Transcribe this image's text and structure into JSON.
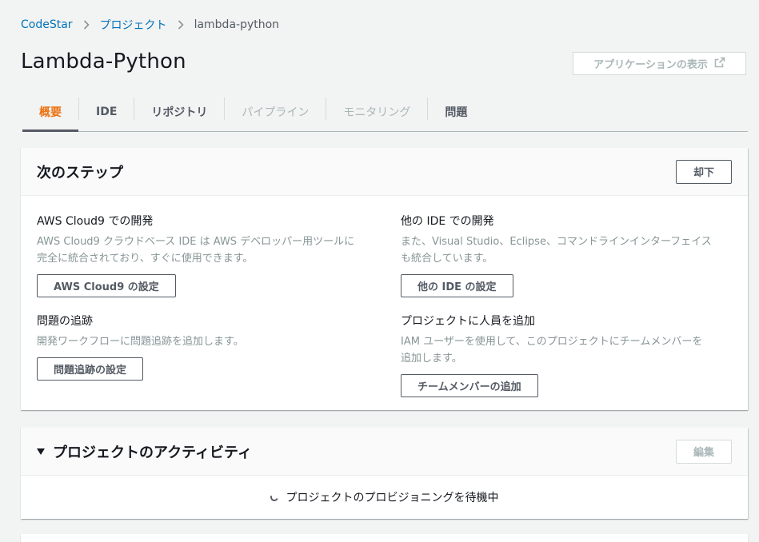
{
  "breadcrumb": {
    "items": [
      {
        "label": "CodeStar"
      },
      {
        "label": "プロジェクト"
      }
    ],
    "current": "lambda-python"
  },
  "page": {
    "title": "Lambda-Python",
    "view_app_label": "アプリケーションの表示",
    "view_app_icon": "external-link-icon"
  },
  "tabs": [
    {
      "label": "概要",
      "state": "active"
    },
    {
      "label": "IDE",
      "state": "enabled"
    },
    {
      "label": "リポジトリ",
      "state": "enabled"
    },
    {
      "label": "パイプライン",
      "state": "disabled"
    },
    {
      "label": "モニタリング",
      "state": "disabled"
    },
    {
      "label": "問題",
      "state": "enabled"
    }
  ],
  "next_steps": {
    "title": "次のステップ",
    "dismiss_label": "却下",
    "cards": [
      {
        "title": "AWS Cloud9 での開発",
        "desc_line1": "AWS Cloud9 クラウドベース IDE は AWS デベロッパー用ツールに",
        "desc_line2": "完全に統合されており、すぐに使用できます。",
        "button": "AWS Cloud9 の設定"
      },
      {
        "title": "他の IDE での開発",
        "desc_line1": "また、Visual Studio、Eclipse、コマンドラインインターフェイス",
        "desc_line2": "も統合しています。",
        "button": "他の IDE の設定"
      },
      {
        "title": "問題の追跡",
        "desc_line1": "開発ワークフローに問題追跡を追加します。",
        "desc_line2": "",
        "button": "問題追跡の設定"
      },
      {
        "title": "プロジェクトに人員を追加",
        "desc_line1": "IAM ユーザーを使用して、このプロジェクトにチームメンバーを",
        "desc_line2": "追加します。",
        "button": "チームメンバーの追加"
      }
    ]
  },
  "activity": {
    "title": "プロジェクトのアクティビティ",
    "edit_label": "編集",
    "loading_text": "プロジェクトのプロビジョニングを待機中"
  },
  "colors": {
    "link": "#0073bb",
    "active_tab": "#ec7211",
    "background": "#f2f3f3"
  }
}
